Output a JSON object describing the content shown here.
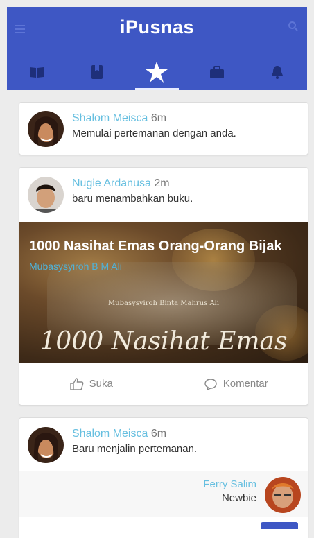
{
  "app": {
    "title": "iPusnas"
  },
  "colors": {
    "primary": "#3e57c4",
    "link": "#66bfe0"
  },
  "tabs": [
    {
      "icon": "book-icon"
    },
    {
      "icon": "bookmark-book-icon"
    },
    {
      "icon": "star-icon",
      "active": true
    },
    {
      "icon": "briefcase-icon"
    },
    {
      "icon": "bell-icon"
    }
  ],
  "feed": [
    {
      "name": "Shalom Meisca",
      "time": "6m",
      "message": "Memulai pertemanan dengan anda."
    },
    {
      "name": "Nugie Ardanusa",
      "time": "2m",
      "message": "baru menambahkan buku.",
      "book": {
        "title": "1000 Nasihat Emas Orang-Orang Bijak",
        "author": "Mubasysyiroh B M Ali",
        "cover_small": "Mubasysyiroh Binta Mahrus Ali",
        "cover_big": "1000 Nasihat Emas"
      },
      "actions": {
        "like": "Suka",
        "comment": "Komentar"
      }
    },
    {
      "name": "Shalom Meisca",
      "time": "6m",
      "message": "Baru menjalin pertemanan.",
      "friend": {
        "name": "Ferry Salim",
        "rank": "Newbie"
      }
    }
  ]
}
